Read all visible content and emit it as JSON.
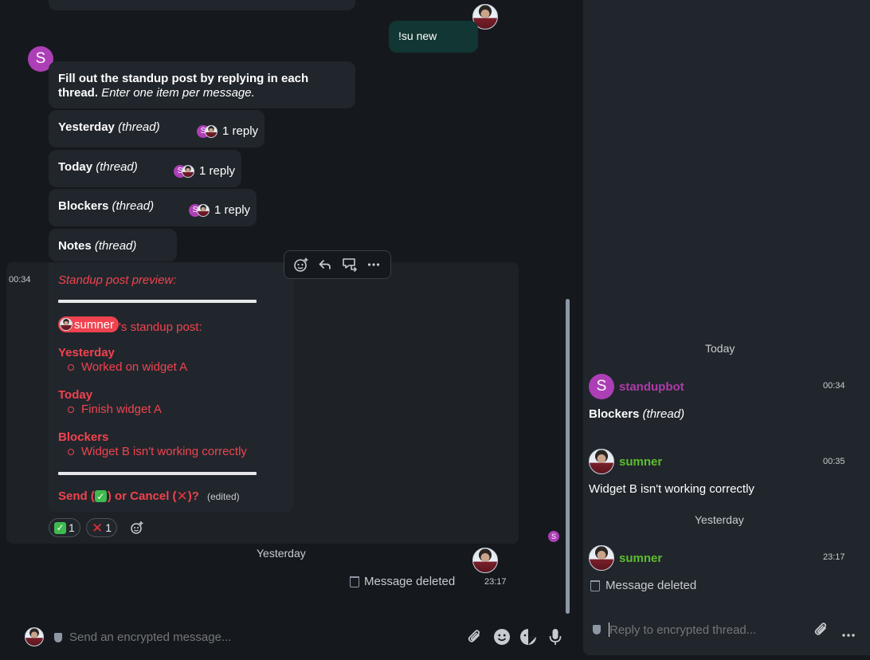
{
  "timeline": {
    "own_command": "!su new",
    "bot_avatar_letter": "S",
    "intro_bold": "Fill out the standup post by replying in each thread.",
    "intro_italic": "Enter one item per message.",
    "threads": [
      {
        "title": "Yesterday",
        "suffix": "(thread)",
        "replies": "1 reply"
      },
      {
        "title": "Today",
        "suffix": "(thread)",
        "replies": "1 reply"
      },
      {
        "title": "Blockers",
        "suffix": "(thread)",
        "replies": "1 reply"
      },
      {
        "title": "Notes",
        "suffix": "(thread)"
      }
    ],
    "preview": {
      "time": "00:34",
      "heading": "Standup post preview:",
      "mention": "sumner",
      "mention_suffix": "'s standup post:",
      "sections": [
        {
          "title": "Yesterday",
          "item": "Worked on widget A"
        },
        {
          "title": "Today",
          "item": "Finish widget A"
        },
        {
          "title": "Blockers",
          "item": "Widget B isn't working correctly"
        }
      ],
      "prompt_prefix": "Send (",
      "prompt_middle": ") or Cancel (",
      "prompt_suffix": ")?",
      "edited": "(edited)",
      "reactions": [
        {
          "emoji": "check",
          "count": "1"
        },
        {
          "emoji": "cross",
          "count": "1"
        }
      ]
    },
    "read_marker_letter": "S",
    "date_yesterday": "Yesterday",
    "deleted_text": "Message deleted",
    "deleted_time": "23:17"
  },
  "composer": {
    "placeholder": "Send an encrypted message..."
  },
  "thread_panel": {
    "date_today": "Today",
    "messages": [
      {
        "sender": "standupbot",
        "avatar_letter": "S",
        "time": "00:34",
        "body_bold": "Blockers",
        "body_italic": "(thread)"
      },
      {
        "sender": "sumner",
        "time": "00:35",
        "body": "Widget B isn't working correctly"
      }
    ],
    "date_yesterday": "Yesterday",
    "deleted_message": {
      "sender": "sumner",
      "time": "23:17",
      "body": "Message deleted"
    },
    "composer_placeholder": "Reply to encrypted thread..."
  },
  "colors": {
    "background": "#15191e",
    "bubble": "#21262c",
    "own_bubble": "#113633",
    "bot_purple": "#ad3fb6",
    "user_green": "#5dbe2f",
    "notice_red": "#f0434f"
  }
}
